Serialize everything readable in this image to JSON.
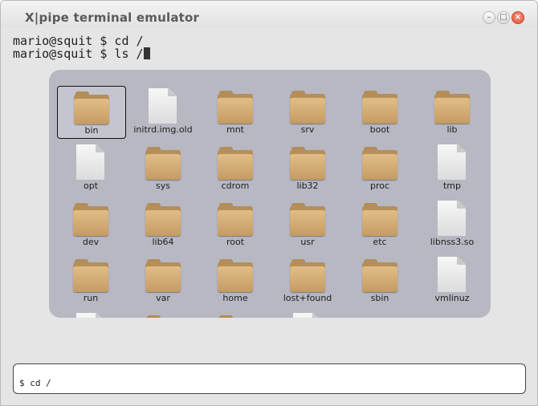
{
  "window": {
    "title": "X|pipe terminal emulator",
    "buttons": {
      "minimize": "–",
      "maximize": "□",
      "close": "×"
    }
  },
  "terminal": {
    "lines": [
      "mario@squit $ cd /",
      "mario@squit $ ls /"
    ]
  },
  "files": [
    {
      "label": "bin",
      "type": "folder",
      "selected": true
    },
    {
      "label": "initrd.img.old",
      "type": "file"
    },
    {
      "label": "mnt",
      "type": "folder"
    },
    {
      "label": "srv",
      "type": "folder"
    },
    {
      "label": "boot",
      "type": "folder"
    },
    {
      "label": "lib",
      "type": "folder"
    },
    {
      "label": "opt",
      "type": "file"
    },
    {
      "label": "sys",
      "type": "folder"
    },
    {
      "label": "cdrom",
      "type": "folder"
    },
    {
      "label": "lib32",
      "type": "folder"
    },
    {
      "label": "proc",
      "type": "folder"
    },
    {
      "label": "tmp",
      "type": "file"
    },
    {
      "label": "dev",
      "type": "folder"
    },
    {
      "label": "lib64",
      "type": "folder"
    },
    {
      "label": "root",
      "type": "folder"
    },
    {
      "label": "usr",
      "type": "folder"
    },
    {
      "label": "etc",
      "type": "folder"
    },
    {
      "label": "libnss3.so",
      "type": "file"
    },
    {
      "label": "run",
      "type": "folder"
    },
    {
      "label": "var",
      "type": "folder"
    },
    {
      "label": "home",
      "type": "folder"
    },
    {
      "label": "lost+found",
      "type": "folder"
    },
    {
      "label": "sbin",
      "type": "folder"
    },
    {
      "label": "vmlinuz",
      "type": "file"
    },
    {
      "label": "",
      "type": "file"
    },
    {
      "label": "",
      "type": "folder"
    },
    {
      "label": "",
      "type": "folder"
    },
    {
      "label": "",
      "type": "file"
    }
  ],
  "command_input": {
    "value": "$ cd /"
  }
}
